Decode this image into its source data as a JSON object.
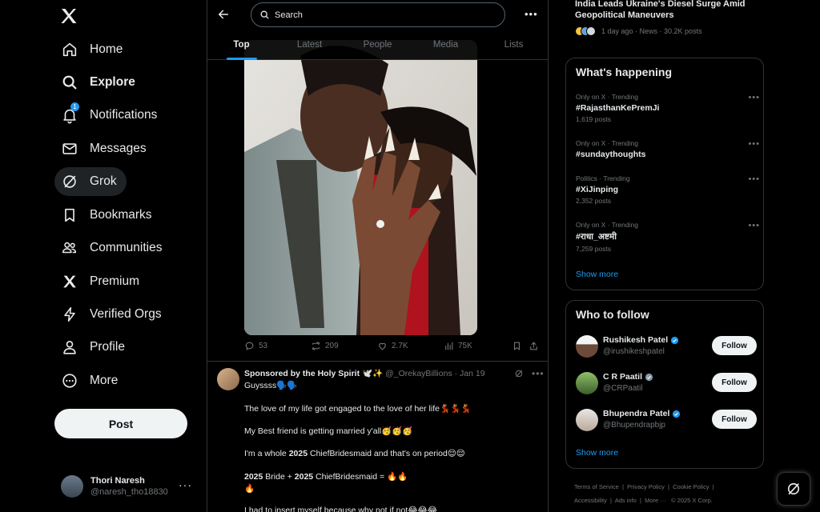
{
  "nav": {
    "items": [
      {
        "label": "Home",
        "icon": "home-icon"
      },
      {
        "label": "Explore",
        "icon": "search-icon"
      },
      {
        "label": "Notifications",
        "icon": "bell-icon",
        "badge": "1"
      },
      {
        "label": "Messages",
        "icon": "envelope-icon"
      },
      {
        "label": "Grok",
        "icon": "grok-icon"
      },
      {
        "label": "Bookmarks",
        "icon": "bookmark-icon"
      },
      {
        "label": "Communities",
        "icon": "people-icon"
      },
      {
        "label": "Premium",
        "icon": "x-logo-icon"
      },
      {
        "label": "Verified Orgs",
        "icon": "lightning-icon"
      },
      {
        "label": "Profile",
        "icon": "person-icon"
      },
      {
        "label": "More",
        "icon": "more-circle-icon"
      }
    ],
    "post_label": "Post",
    "account": {
      "name": "Thori Naresh",
      "handle": "@naresh_tho18830"
    }
  },
  "search": {
    "placeholder": "Search"
  },
  "tabs": [
    "Top",
    "Latest",
    "People",
    "Media",
    "Lists"
  ],
  "tweet1": {
    "replies": "53",
    "reposts": "209",
    "likes": "2.7K",
    "views": "75K"
  },
  "tweet2": {
    "author": "Sponsored by the Holy Spirit 🕊️✨",
    "handle": "@_OrekayBillions",
    "date": "Jan 19",
    "lines": [
      "Guyssss🗣️🗣️",
      "The love of my life got engaged to the love of her life💃💃💃",
      "My Best friend is getting married y'all🥳🥳🥳",
      "I'm a whole",
      "2025",
      "ChiefBridesmaid and that's on period😌😌",
      "2025",
      "Bride +",
      "2025",
      "ChiefBridesmaid = 🔥🔥",
      "🔥",
      "I had to insert myself because why not if not😂😂😂"
    ]
  },
  "news": {
    "title": "India Leads Ukraine's Diesel Surge Amid Geopolitical Maneuvers",
    "meta": "1 day ago · News · 30.2K posts"
  },
  "happening": {
    "title": "What's happening",
    "trends": [
      {
        "context": "Only on X · Trending",
        "title": "#RajasthanKePremJi",
        "count": "1,619 posts"
      },
      {
        "context": "Only on X · Trending",
        "title": "#sundaythoughts",
        "count": ""
      },
      {
        "context": "Politics · Trending",
        "title": "#XiJinping",
        "count": "2,352 posts"
      },
      {
        "context": "Only on X · Trending",
        "title": "#राधा_अष्टमी",
        "count": "7,259 posts"
      }
    ],
    "show_more": "Show more"
  },
  "who_to_follow": {
    "title": "Who to follow",
    "users": [
      {
        "name": "Rushikesh Patel",
        "handle": "@irushikeshpatel",
        "badge_color": "#1d9bf0"
      },
      {
        "name": "C R Paatil",
        "handle": "@CRPaatil",
        "badge_color": "#829aab"
      },
      {
        "name": "Bhupendra Patel",
        "handle": "@Bhupendrapbjp",
        "badge_color": "#1d9bf0"
      }
    ],
    "follow_label": "Follow",
    "show_more": "Show more"
  },
  "footer": {
    "links": [
      "Terms of Service",
      "Privacy Policy",
      "Cookie Policy",
      "Accessibility",
      "Ads info",
      "More ···"
    ],
    "copyright": "© 2025 X Corp."
  },
  "colors": {
    "accent": "#1d9bf0",
    "background": "#000000",
    "border": "#2f3336"
  }
}
